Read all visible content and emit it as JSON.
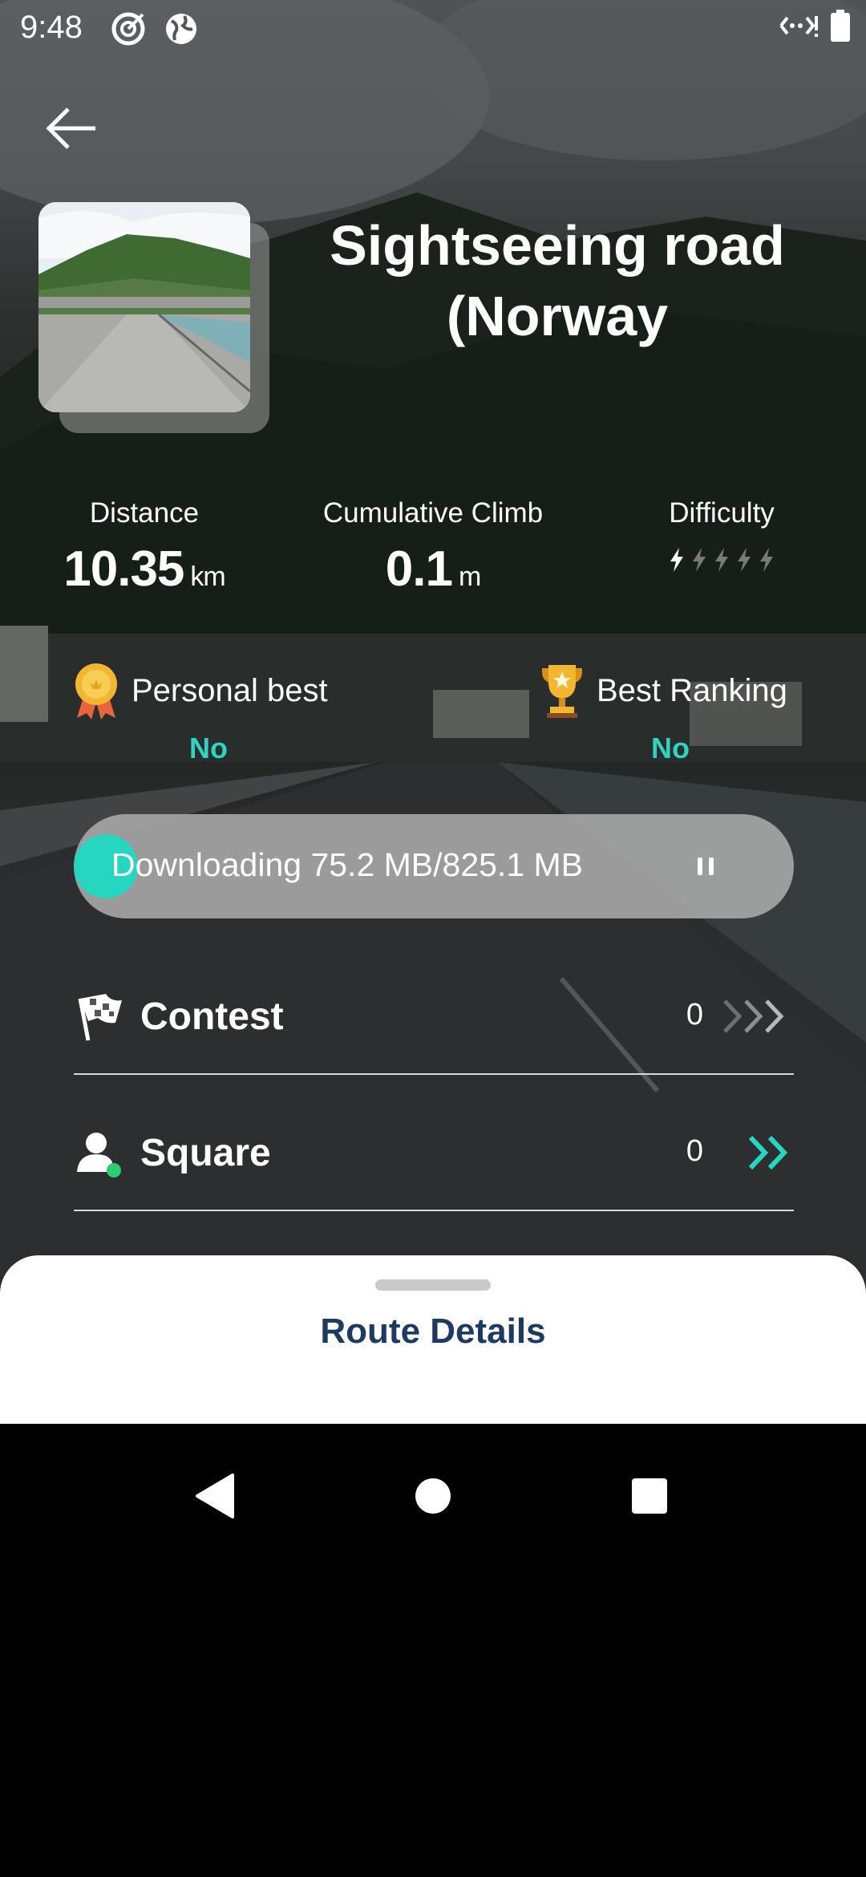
{
  "status_bar": {
    "time": "9:48"
  },
  "route": {
    "title": "Sightseeing road (Norway"
  },
  "stats": {
    "distance": {
      "label": "Distance",
      "value": "10.35",
      "unit": "km"
    },
    "climb": {
      "label": "Cumulative Climb",
      "value": "0.1",
      "unit": "m"
    },
    "difficulty": {
      "label": "Difficulty",
      "level": 1,
      "max": 5
    }
  },
  "personal_best": {
    "label": "Personal best",
    "value": "No"
  },
  "best_ranking": {
    "label": "Best Ranking",
    "value": "No"
  },
  "download": {
    "text": "Downloading 75.2 MB/825.1 MB",
    "progress_fraction": 0.091
  },
  "contest": {
    "label": "Contest",
    "count": "0"
  },
  "square": {
    "label": "Square",
    "count": "0"
  },
  "sheet": {
    "title": "Route Details"
  },
  "colors": {
    "accent": "#27d6c1",
    "sheet_title": "#1d3a63",
    "ok_badge": "#2ecc71"
  }
}
